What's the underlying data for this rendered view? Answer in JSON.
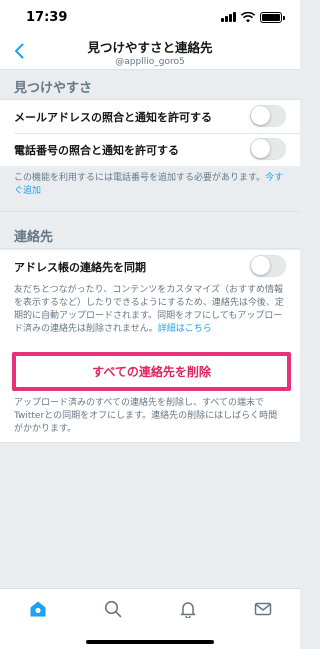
{
  "status_bar": {
    "time": "17:39"
  },
  "nav": {
    "title": "見つけやすさと連絡先",
    "subtitle": "@appllio_goro5"
  },
  "discoverability": {
    "header": "見つけやすさ",
    "email_row": {
      "label": "メールアドレスの照合と通知を許可する",
      "enabled": false
    },
    "phone_row": {
      "label": "電話番号の照合と通知を許可する",
      "enabled": false
    },
    "note_text": "この機能を利用するには電話番号を追加する必要があります。",
    "note_link": "今すぐ追加"
  },
  "contacts": {
    "header": "連絡先",
    "sync_row": {
      "label": "アドレス帳の連絡先を同期",
      "enabled": false
    },
    "note_text": "友だちとつながったり、コンテンツをカスタマイズ（おすすめ情報を表示するなど）したりできるようにするため、連絡先は今後、定期的に自動アップロードされます。同期をオフにしてもアップロード済みの連絡先は削除されません。",
    "note_link": "詳細はこちら",
    "delete_button": "すべての連絡先を削除",
    "delete_note": "アップロード済みのすべての連絡先を削除し、すべての端末でTwitterとの同期をオフにします。連絡先の削除にはしばらく時間がかかります。"
  },
  "tab_bar": {
    "items": [
      {
        "icon": "home-icon",
        "active": true
      },
      {
        "icon": "search-icon",
        "active": false
      },
      {
        "icon": "bell-icon",
        "active": false
      },
      {
        "icon": "mail-icon",
        "active": false
      }
    ]
  },
  "colors": {
    "accent": "#1da1f2",
    "danger": "#e0245e",
    "highlight": "#e8317a",
    "background": "#e9edf0"
  }
}
